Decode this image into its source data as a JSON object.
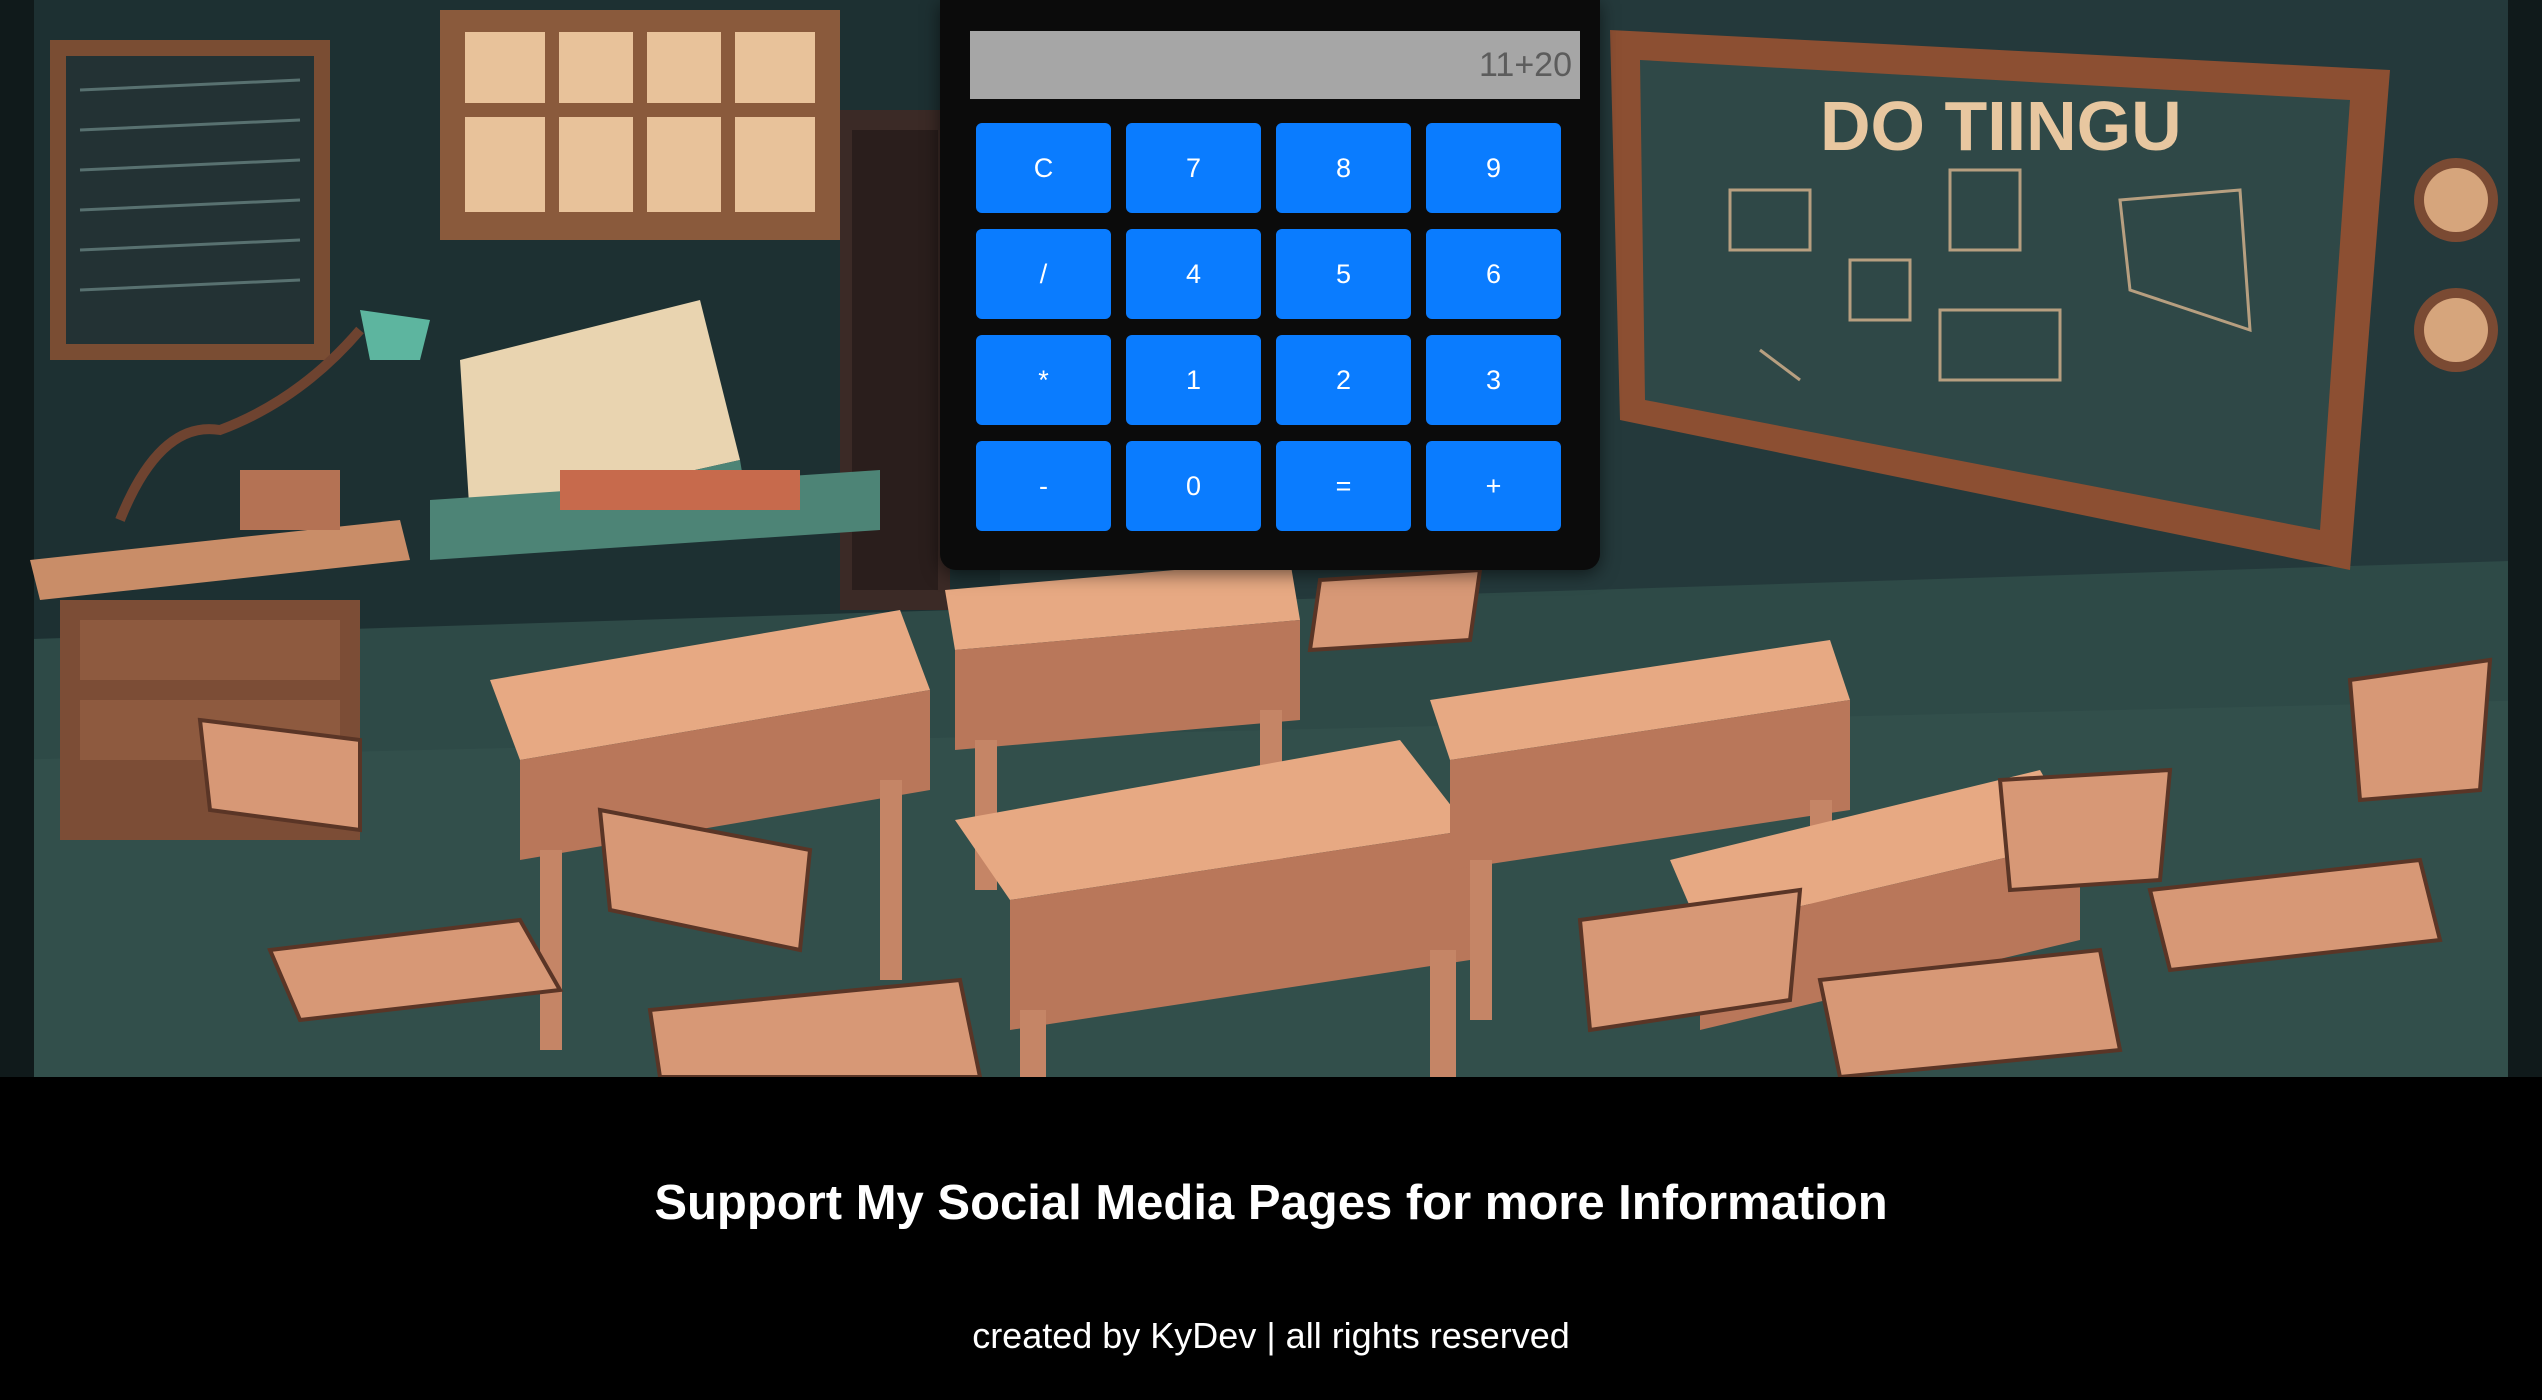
{
  "background": {
    "description_icon": "classroom-illustration",
    "chalkboard_text": "DO TIINGU"
  },
  "calculator": {
    "display_value": "11+20",
    "keys": [
      {
        "label": "C",
        "name": "clear-button"
      },
      {
        "label": "7",
        "name": "key-7-button"
      },
      {
        "label": "8",
        "name": "key-8-button"
      },
      {
        "label": "9",
        "name": "key-9-button"
      },
      {
        "label": "/",
        "name": "divide-button"
      },
      {
        "label": "4",
        "name": "key-4-button"
      },
      {
        "label": "5",
        "name": "key-5-button"
      },
      {
        "label": "6",
        "name": "key-6-button"
      },
      {
        "label": "*",
        "name": "multiply-button"
      },
      {
        "label": "1",
        "name": "key-1-button"
      },
      {
        "label": "2",
        "name": "key-2-button"
      },
      {
        "label": "3",
        "name": "key-3-button"
      },
      {
        "label": "-",
        "name": "subtract-button"
      },
      {
        "label": "0",
        "name": "key-0-button"
      },
      {
        "label": "=",
        "name": "equals-button"
      },
      {
        "label": "+",
        "name": "add-button"
      }
    ]
  },
  "footer": {
    "heading": "Support My Social Media Pages for more Information",
    "credit": "created by KyDev | all rights reserved"
  },
  "colors": {
    "key_background": "#0a7cff",
    "display_background": "#a6a6a6",
    "calculator_body": "#0b0b0b",
    "footer_background": "#000000"
  }
}
